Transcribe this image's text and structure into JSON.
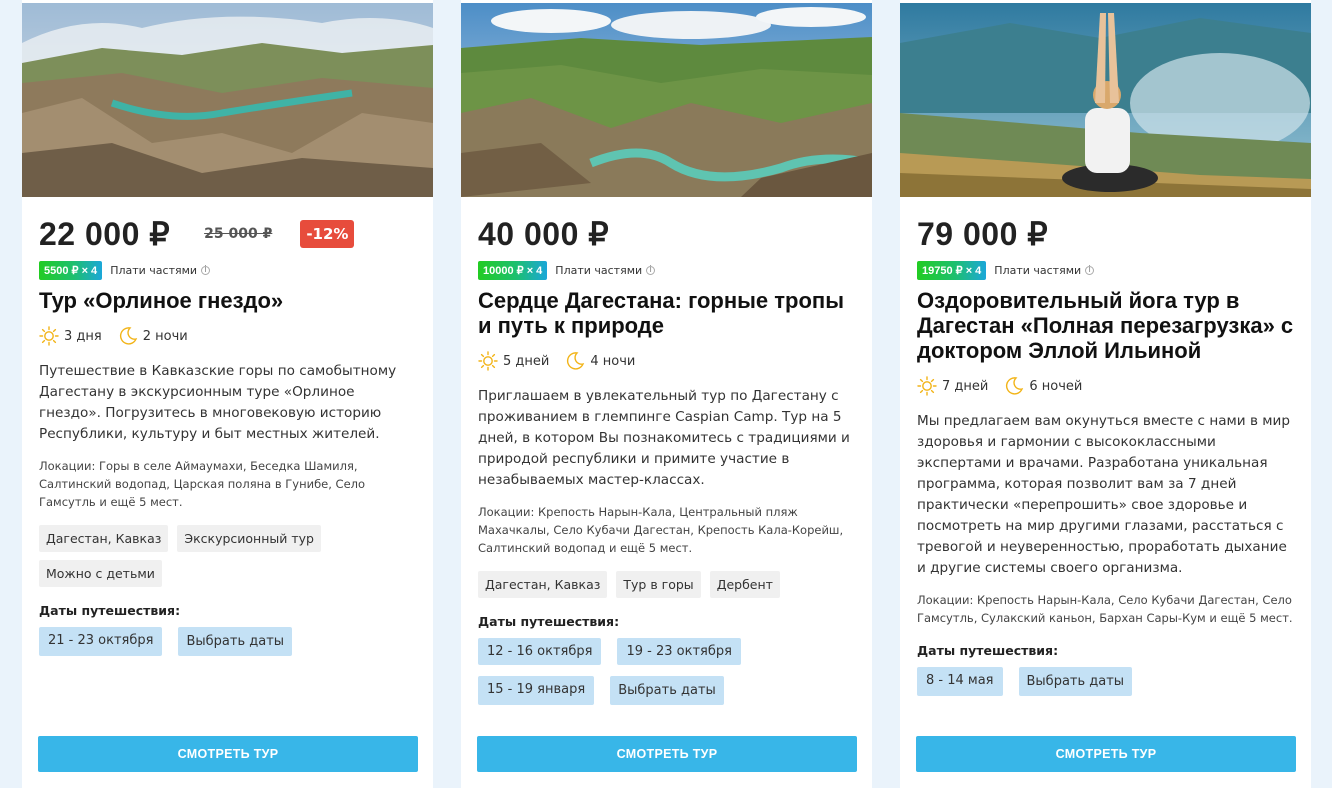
{
  "cards": [
    {
      "price": "22 000 ₽",
      "old_price": "25 000 ₽",
      "discount": "-12%",
      "installment_badge": "5500 ₽ × 4",
      "installment_text": "Плати частями",
      "title": "Тур «Орлиное гнездо»",
      "days": "3 дня",
      "nights": "2 ночи",
      "description": "Путешествие в Кавказские горы по самобытному Дагестану в экскурсионным туре «Орлиное гнездо». Погрузитесь в многовековую историю Республики, культуру и быт местных жителей.",
      "locations": "Локации: Горы в селе Аймаумахи, Беседка Шамиля, Салтинский водопад, Царская поляна в Гунибе, Село Гамсутль и ещё 5 мест.",
      "tags": [
        "Дагестан, Кавказ",
        "Экскурсионный тур",
        "Можно с детьми"
      ],
      "dates_label": "Даты путешествия:",
      "dates": [
        "21 - 23 октября"
      ],
      "select_dates": "Выбрать даты",
      "cta": "СМОТРЕТЬ ТУР"
    },
    {
      "price": "40 000 ₽",
      "installment_badge": "10000 ₽ × 4",
      "installment_text": "Плати частями",
      "title": "Сердце Дагестана: горные тропы и путь к природе",
      "days": "5 дней",
      "nights": "4 ночи",
      "description": "Приглашаем в увлекательный тур по Дагестану с проживанием в глемпинге Caspian Camp. Тур на 5 дней, в котором Вы познакомитесь с традициями и природой республики и примите участие в незабываемых мастер-классах.",
      "locations": "Локации: Крепость Нарын-Кала, Центральный пляж Махачкалы, Село Кубачи Дагестан, Крепость Кала-Корейш, Салтинский водопад и ещё 5 мест.",
      "tags": [
        "Дагестан, Кавказ",
        "Тур в горы",
        "Дербент"
      ],
      "dates_label": "Даты путешествия:",
      "dates": [
        "12 - 16 октября",
        "19 - 23 октября",
        "15 - 19 января"
      ],
      "select_dates": "Выбрать даты",
      "cta": "СМОТРЕТЬ ТУР"
    },
    {
      "price": "79 000 ₽",
      "installment_badge": "19750 ₽ × 4",
      "installment_text": "Плати частями",
      "title": "Оздоровительный йога тур в Дагестан «Полная перезагрузка» с доктором Эллой Ильиной",
      "days": "7 дней",
      "nights": "6 ночей",
      "description": "Мы предлагаем вам окунуться вместе с нами в мир здоровья и гармонии с высококлассными экспертами и врачами. Разработана уникальная программа, которая позволит вам за 7 дней практически «перепрошить» свое здоровье и посмотреть на мир другими глазами, расстаться с тревогой и неуверенностью, проработать дыхание и другие системы своего организма.",
      "locations": "Локации: Крепость Нарын-Кала, Село Кубачи Дагестан, Село Гамсутль, Сулакский каньон, Бархан Сары-Кум и ещё 5 мест.",
      "tags": [],
      "dates_label": "Даты путешествия:",
      "dates": [
        "8 - 14 мая"
      ],
      "select_dates": "Выбрать даты",
      "cta": "СМОТРЕТЬ ТУР"
    }
  ]
}
